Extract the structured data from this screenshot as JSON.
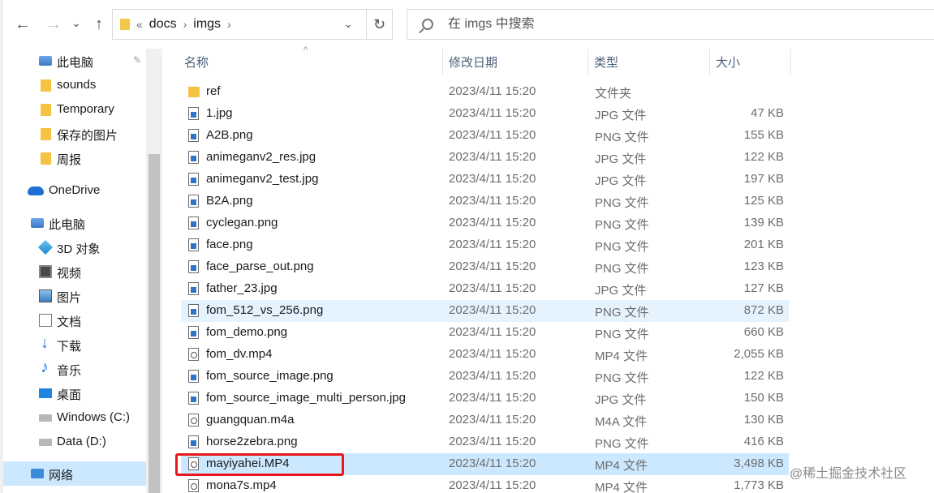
{
  "toolbar": {
    "back_glyph": "←",
    "forward_glyph": "→",
    "recent_glyph": "⌄",
    "up_glyph": "↑",
    "breadcrumb_overflow": "«",
    "breadcrumb": [
      "docs",
      "imgs"
    ],
    "address_dropdown_glyph": "⌄",
    "refresh_glyph": "↻",
    "search_placeholder": "在 imgs 中搜索"
  },
  "sidebar": {
    "items": [
      {
        "label": "此电脑",
        "icon": "pc-icon",
        "pinned": true
      },
      {
        "label": "sounds",
        "icon": "folder-icon"
      },
      {
        "label": "Temporary",
        "icon": "folder-icon"
      },
      {
        "label": "保存的图片",
        "icon": "folder-icon"
      },
      {
        "label": "周报",
        "icon": "folder-icon"
      },
      {
        "label": "OneDrive",
        "icon": "cloud-icon"
      },
      {
        "label": "此电脑",
        "icon": "pc-icon"
      },
      {
        "label": "3D 对象",
        "icon": "3d-objects-icon"
      },
      {
        "label": "视频",
        "icon": "video-icon"
      },
      {
        "label": "图片",
        "icon": "pictures-icon"
      },
      {
        "label": "文档",
        "icon": "documents-icon"
      },
      {
        "label": "下载",
        "icon": "download-icon"
      },
      {
        "label": "音乐",
        "icon": "music-icon"
      },
      {
        "label": "桌面",
        "icon": "desktop-icon"
      },
      {
        "label": "Windows (C:)",
        "icon": "drive-icon"
      },
      {
        "label": "Data (D:)",
        "icon": "drive-icon"
      },
      {
        "label": "网络",
        "icon": "network-icon",
        "selected": true
      }
    ],
    "pin_glyph": "📌"
  },
  "columns": {
    "name": "名称",
    "date": "修改日期",
    "type": "类型",
    "size": "大小",
    "sort_glyph": "^"
  },
  "files": [
    {
      "name": "ref",
      "date": "2023/4/11 15:20",
      "type": "文件夹",
      "size": "",
      "kind": "folder"
    },
    {
      "name": "1.jpg",
      "date": "2023/4/11 15:20",
      "type": "JPG 文件",
      "size": "47 KB",
      "kind": "img"
    },
    {
      "name": "A2B.png",
      "date": "2023/4/11 15:20",
      "type": "PNG 文件",
      "size": "155 KB",
      "kind": "img"
    },
    {
      "name": "animeganv2_res.jpg",
      "date": "2023/4/11 15:20",
      "type": "JPG 文件",
      "size": "122 KB",
      "kind": "img"
    },
    {
      "name": "animeganv2_test.jpg",
      "date": "2023/4/11 15:20",
      "type": "JPG 文件",
      "size": "197 KB",
      "kind": "img"
    },
    {
      "name": "B2A.png",
      "date": "2023/4/11 15:20",
      "type": "PNG 文件",
      "size": "125 KB",
      "kind": "img"
    },
    {
      "name": "cyclegan.png",
      "date": "2023/4/11 15:20",
      "type": "PNG 文件",
      "size": "139 KB",
      "kind": "img"
    },
    {
      "name": "face.png",
      "date": "2023/4/11 15:20",
      "type": "PNG 文件",
      "size": "201 KB",
      "kind": "img"
    },
    {
      "name": "face_parse_out.png",
      "date": "2023/4/11 15:20",
      "type": "PNG 文件",
      "size": "123 KB",
      "kind": "img"
    },
    {
      "name": "father_23.jpg",
      "date": "2023/4/11 15:20",
      "type": "JPG 文件",
      "size": "127 KB",
      "kind": "img"
    },
    {
      "name": "fom_512_vs_256.png",
      "date": "2023/4/11 15:20",
      "type": "PNG 文件",
      "size": "872 KB",
      "kind": "img",
      "state": "hover"
    },
    {
      "name": "fom_demo.png",
      "date": "2023/4/11 15:20",
      "type": "PNG 文件",
      "size": "660 KB",
      "kind": "img"
    },
    {
      "name": "fom_dv.mp4",
      "date": "2023/4/11 15:20",
      "type": "MP4 文件",
      "size": "2,055 KB",
      "kind": "vid"
    },
    {
      "name": "fom_source_image.png",
      "date": "2023/4/11 15:20",
      "type": "PNG 文件",
      "size": "122 KB",
      "kind": "img"
    },
    {
      "name": "fom_source_image_multi_person.jpg",
      "date": "2023/4/11 15:20",
      "type": "JPG 文件",
      "size": "150 KB",
      "kind": "img"
    },
    {
      "name": "guangquan.m4a",
      "date": "2023/4/11 15:20",
      "type": "M4A 文件",
      "size": "130 KB",
      "kind": "vid"
    },
    {
      "name": "horse2zebra.png",
      "date": "2023/4/11 15:20",
      "type": "PNG 文件",
      "size": "416 KB",
      "kind": "img"
    },
    {
      "name": "mayiyahei.MP4",
      "date": "2023/4/11 15:20",
      "type": "MP4 文件",
      "size": "3,498 KB",
      "kind": "vid",
      "state": "selected"
    },
    {
      "name": "mona7s.mp4",
      "date": "2023/4/11 15:20",
      "type": "MP4 文件",
      "size": "1,773 KB",
      "kind": "vid"
    }
  ],
  "watermark": "@稀土掘金技术社区",
  "colors": {
    "selected": "#cce8ff",
    "hover": "#e5f3ff",
    "highlight_box": "#e8171d",
    "folder": "#f5c342"
  }
}
